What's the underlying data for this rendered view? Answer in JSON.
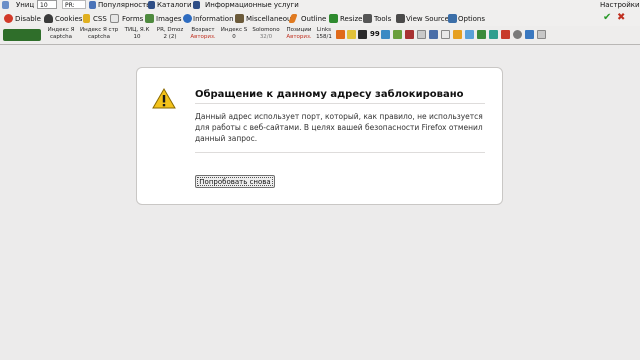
{
  "toolbar_top": {
    "partial_label": "Униц",
    "partial_value": "10",
    "pr_label": "PR:",
    "popularity": "Популярность",
    "catalogs": "Каталоги",
    "info_services": "Информационные услуги",
    "settings": "Настройки"
  },
  "webdev_toolbar": {
    "disable": "Disable",
    "cookies": "Cookies",
    "css": "CSS",
    "forms": "Forms",
    "images": "Images",
    "information": "Information",
    "miscellaneous": "Miscellaneous",
    "outline": "Outline",
    "resize": "Resize",
    "tools": "Tools",
    "view_source": "View Source",
    "options": "Options"
  },
  "seo_bar": {
    "metrics": [
      {
        "title": "Индекс Я",
        "value": "captcha"
      },
      {
        "title": "Индекс Я стр",
        "value": "captcha"
      },
      {
        "title": "ТИЦ, Я.К",
        "value": "10"
      },
      {
        "title": "PR, Dmoz",
        "value": "2 (2)"
      },
      {
        "title": "Возраст",
        "value": "Авториз."
      },
      {
        "title": "Индекс S",
        "value": "0"
      },
      {
        "title": "Solomono",
        "value": "32/0"
      },
      {
        "title": "Позиции",
        "value": "Авториз."
      },
      {
        "title": "Links",
        "value": "158/1"
      }
    ],
    "badge_count": "99"
  },
  "error_page": {
    "title": "Обращение к данному адресу заблокировано",
    "description": "Данный адрес использует порт, который, как правило, не используется для работы с веб-сайтами. В целях вашей безопасности Firefox отменил данный запрос.",
    "retry_button": "Попробовать снова"
  }
}
